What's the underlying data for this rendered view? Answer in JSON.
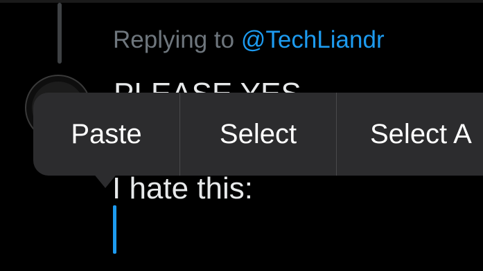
{
  "reply_context": {
    "prefix": "Replying to",
    "handle": "@TechLiandr"
  },
  "compose": {
    "line1": "PLEASE YES",
    "line2": "I hate this:"
  },
  "edit_menu": {
    "items": [
      {
        "label": "Paste"
      },
      {
        "label": "Select"
      },
      {
        "label": "Select A"
      }
    ]
  },
  "colors": {
    "background": "#000000",
    "link": "#1d9bf0",
    "muted_text": "#6e767d",
    "menu_background": "#2c2c2e"
  }
}
